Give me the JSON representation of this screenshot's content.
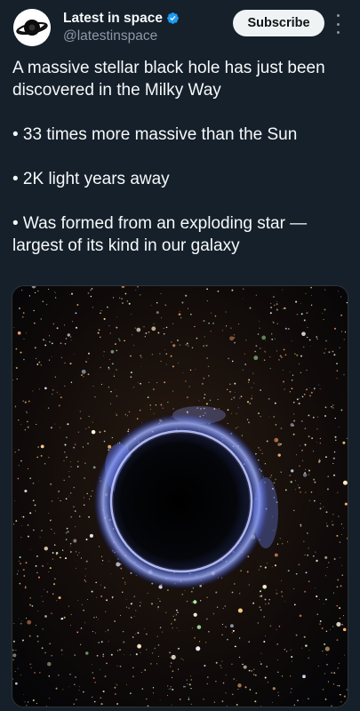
{
  "account": {
    "display_name": "Latest in space",
    "handle": "@latestinspace",
    "verified": true,
    "avatar_icon": "saturn-black-hole-logo-icon"
  },
  "actions": {
    "subscribe_label": "Subscribe",
    "more_icon": "more-vertical-icon"
  },
  "tweet": {
    "headline": "A massive stellar black hole has just been discovered in the Milky Way",
    "bullets": [
      "• 33 times more massive than the Sun",
      "• 2K light years away",
      "• Was formed from an exploding star — largest of its kind in our galaxy"
    ]
  },
  "media": {
    "alt_subject": "black-hole-in-star-field-image"
  },
  "colors": {
    "background": "#15202b",
    "text_primary": "#f7f9f9",
    "text_secondary": "#8b98a5",
    "verified_badge": "#1d9bf0",
    "button_bg": "#eff3f4",
    "button_text": "#0f1419"
  }
}
